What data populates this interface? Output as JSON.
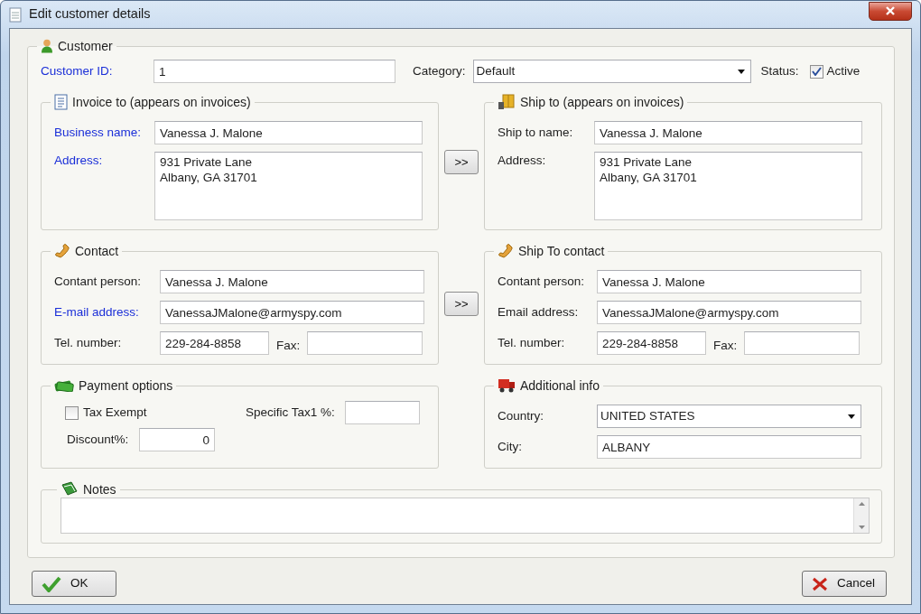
{
  "window": {
    "title": "Edit customer details"
  },
  "customer": {
    "legend": "Customer",
    "customer_id": {
      "label": "Customer ID:",
      "value": "1",
      "required": true
    },
    "category": {
      "label": "Category:",
      "value": "Default"
    },
    "status": {
      "label": "Status:",
      "checkbox_label": "Active",
      "checked": true
    }
  },
  "invoice_to": {
    "legend": "Invoice to (appears on invoices)",
    "copy_button": ">>",
    "fields": [
      {
        "kind": "text",
        "label": "Business name:",
        "value": "Vanessa J. Malone",
        "required": true
      },
      {
        "kind": "multiline",
        "label": "Address:",
        "value": "931 Private Lane\nAlbany, GA 31701",
        "required": true
      }
    ]
  },
  "ship_to": {
    "legend": "Ship to (appears on invoices)",
    "fields": [
      {
        "kind": "text",
        "label": "Ship to name:",
        "value": "Vanessa J. Malone",
        "required": false
      },
      {
        "kind": "multiline",
        "label": "Address:",
        "value": "931 Private Lane\nAlbany, GA 31701",
        "required": false
      }
    ]
  },
  "contact": {
    "legend": "Contact",
    "copy_button": ">>",
    "fields": [
      {
        "kind": "text",
        "label": "Contant person:",
        "value": "Vanessa J. Malone",
        "required": false
      },
      {
        "kind": "text",
        "label": "E-mail address:",
        "value": "VanessaJMalone@armyspy.com",
        "required": true
      },
      {
        "kind": "phone_fax",
        "label": "Tel. number:",
        "value": "229-284-8858",
        "fax_label": "Fax:",
        "required": false
      }
    ]
  },
  "ship_contact": {
    "legend": "Ship To contact",
    "fields": [
      {
        "kind": "text",
        "label": "Contant person:",
        "value": "Vanessa J. Malone",
        "required": false
      },
      {
        "kind": "text",
        "label": "Email address:",
        "value": "VanessaJMalone@armyspy.com",
        "required": false
      },
      {
        "kind": "phone_fax",
        "label": "Tel. number:",
        "value": "229-284-8858",
        "fax_label": "Fax:",
        "required": false
      }
    ]
  },
  "payment": {
    "legend": "Payment options",
    "tax_exempt": {
      "label": "Tax Exempt",
      "checked": false
    },
    "specific_tax": {
      "label": "Specific Tax1 %:"
    },
    "discount": {
      "label": "Discount%:",
      "value": "0"
    }
  },
  "additional_info": {
    "legend": "Additional info",
    "fields": [
      {
        "kind": "dropdown",
        "label": "Country:",
        "value": "UNITED STATES",
        "required": false
      },
      {
        "kind": "text",
        "label": "City:",
        "value": "ALBANY",
        "required": false
      }
    ]
  },
  "notes": {
    "legend": "Notes"
  },
  "buttons": [
    {
      "kind": "ok",
      "label": "OK"
    },
    {
      "kind": "cancel",
      "label": "Cancel"
    }
  ]
}
